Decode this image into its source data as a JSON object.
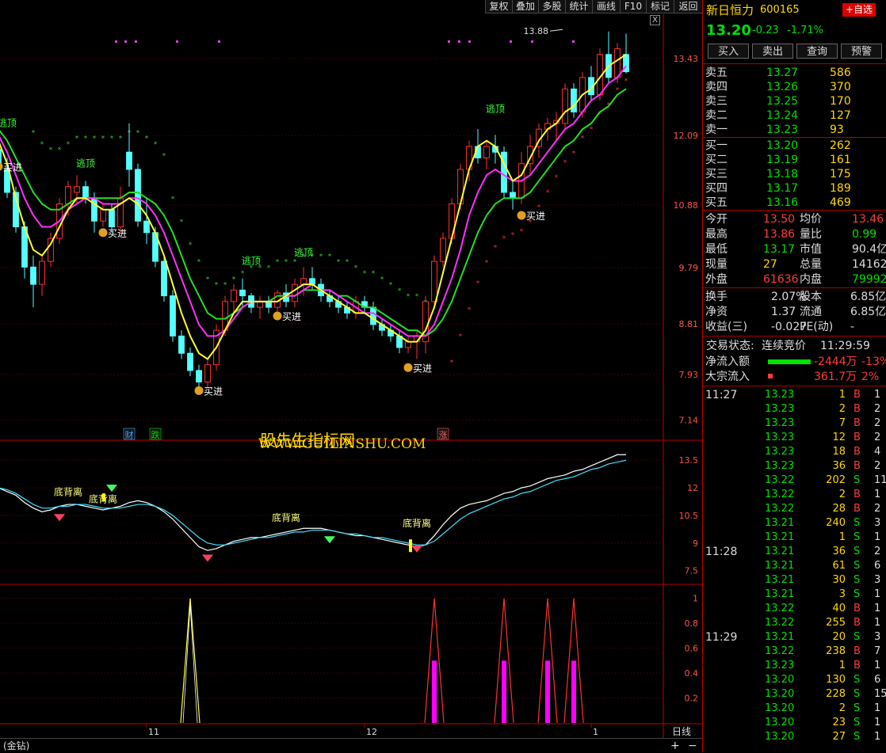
{
  "toolbar": {
    "items": [
      "复权",
      "叠加",
      "多股",
      "统计",
      "画线",
      "F10",
      "标记",
      "返回"
    ]
  },
  "close_glyph": "X",
  "stock": {
    "name": "新日恒力",
    "code": "600165",
    "self_select": "+自选",
    "price": "13.20",
    "change": "-0.23",
    "pct": "-1.71%"
  },
  "actions": [
    "买入",
    "卖出",
    "查询",
    "预警"
  ],
  "sell": [
    {
      "label": "卖五",
      "price": "13.27",
      "vol": "586"
    },
    {
      "label": "卖四",
      "price": "13.26",
      "vol": "370"
    },
    {
      "label": "卖三",
      "price": "13.25",
      "vol": "170"
    },
    {
      "label": "卖二",
      "price": "13.24",
      "vol": "127"
    },
    {
      "label": "卖一",
      "price": "13.23",
      "vol": "93"
    }
  ],
  "buy": [
    {
      "label": "买一",
      "price": "13.20",
      "vol": "262"
    },
    {
      "label": "买二",
      "price": "13.19",
      "vol": "161"
    },
    {
      "label": "买三",
      "price": "13.18",
      "vol": "175"
    },
    {
      "label": "买四",
      "price": "13.17",
      "vol": "189"
    },
    {
      "label": "买五",
      "price": "13.16",
      "vol": "469"
    }
  ],
  "stats": [
    {
      "l1": "今开",
      "v1": "13.50",
      "l2": "均价",
      "v2": "13.46"
    },
    {
      "l1": "最高",
      "v1": "13.86",
      "l2": "量比",
      "v2": "0.99"
    },
    {
      "l1": "最低",
      "v1": "13.17",
      "l2": "市值",
      "v2": "90.4亿"
    },
    {
      "l1": "现量",
      "v1": "27",
      "l2": "总量",
      "v2": "14162"
    },
    {
      "l1": "外盘",
      "v1": "61636",
      "l2": "内盘",
      "v2": "79992"
    }
  ],
  "stats2": [
    {
      "l1": "换手",
      "v1": "2.07%",
      "l2": "股本",
      "v2": "6.85亿"
    },
    {
      "l1": "净资",
      "v1": "1.37",
      "l2": "流通",
      "v2": "6.85亿"
    },
    {
      "l1": "收益(三)",
      "v1": "-0.027",
      "l2": "PE(动)",
      "v2": "-"
    }
  ],
  "trade_status": {
    "label": "交易状态:",
    "value": "连续竞价",
    "time": "11:29:59"
  },
  "flows": [
    {
      "label": "净流入额",
      "value": "-2444万",
      "pct": "-13%"
    },
    {
      "label": "大宗流入",
      "value": "361.7万",
      "pct": "2%"
    }
  ],
  "ticks": [
    {
      "t": "11:27",
      "p": "13.23",
      "v": "1",
      "s": "B",
      "n": "1"
    },
    {
      "t": "",
      "p": "13.23",
      "v": "2",
      "s": "B",
      "n": "2"
    },
    {
      "t": "",
      "p": "13.23",
      "v": "7",
      "s": "B",
      "n": "2"
    },
    {
      "t": "",
      "p": "13.23",
      "v": "12",
      "s": "B",
      "n": "2"
    },
    {
      "t": "",
      "p": "13.23",
      "v": "18",
      "s": "B",
      "n": "4"
    },
    {
      "t": "",
      "p": "13.23",
      "v": "36",
      "s": "B",
      "n": "2"
    },
    {
      "t": "",
      "p": "13.22",
      "v": "202",
      "s": "S",
      "n": "11"
    },
    {
      "t": "",
      "p": "13.22",
      "v": "2",
      "s": "B",
      "n": "1"
    },
    {
      "t": "",
      "p": "13.22",
      "v": "28",
      "s": "B",
      "n": "2"
    },
    {
      "t": "",
      "p": "13.21",
      "v": "240",
      "s": "S",
      "n": "3"
    },
    {
      "t": "",
      "p": "13.21",
      "v": "1",
      "s": "S",
      "n": "1"
    },
    {
      "t": "11:28",
      "p": "13.21",
      "v": "36",
      "s": "S",
      "n": "2"
    },
    {
      "t": "",
      "p": "13.21",
      "v": "61",
      "s": "S",
      "n": "6"
    },
    {
      "t": "",
      "p": "13.21",
      "v": "30",
      "s": "S",
      "n": "3"
    },
    {
      "t": "",
      "p": "13.21",
      "v": "3",
      "s": "S",
      "n": "1"
    },
    {
      "t": "",
      "p": "13.22",
      "v": "40",
      "s": "B",
      "n": "1"
    },
    {
      "t": "",
      "p": "13.22",
      "v": "255",
      "s": "B",
      "n": "1"
    },
    {
      "t": "11:29",
      "p": "13.21",
      "v": "20",
      "s": "S",
      "n": "3"
    },
    {
      "t": "",
      "p": "13.22",
      "v": "238",
      "s": "B",
      "n": "7"
    },
    {
      "t": "",
      "p": "13.23",
      "v": "1",
      "s": "B",
      "n": "1"
    },
    {
      "t": "",
      "p": "13.20",
      "v": "130",
      "s": "S",
      "n": "6"
    },
    {
      "t": "",
      "p": "13.20",
      "v": "228",
      "s": "S",
      "n": "15"
    },
    {
      "t": "",
      "p": "13.20",
      "v": "2",
      "s": "S",
      "n": "1"
    },
    {
      "t": "",
      "p": "13.20",
      "v": "23",
      "s": "S",
      "n": "1"
    },
    {
      "t": "",
      "p": "13.20",
      "v": "27",
      "s": "S",
      "n": "1"
    }
  ],
  "chart_data": {
    "type": "candlestick",
    "price_axis": {
      "ticks": [
        13.43,
        12.09,
        10.88,
        9.79,
        8.81,
        7.93,
        7.14
      ],
      "range": [
        6.8,
        14.2
      ]
    },
    "candles": [
      [
        11.85,
        12.0,
        11.2,
        11.5
      ],
      [
        11.5,
        11.7,
        11.0,
        11.1
      ],
      [
        11.1,
        11.2,
        10.4,
        10.5
      ],
      [
        10.5,
        10.6,
        9.6,
        9.8
      ],
      [
        9.8,
        10.0,
        9.1,
        9.5
      ],
      [
        9.5,
        10.0,
        9.3,
        9.9
      ],
      [
        9.9,
        10.4,
        9.8,
        10.3
      ],
      [
        10.3,
        11.0,
        10.2,
        10.9
      ],
      [
        10.9,
        11.3,
        10.7,
        11.2
      ],
      [
        11.1,
        11.4,
        10.9,
        11.2
      ],
      [
        11.2,
        11.3,
        10.9,
        11.0
      ],
      [
        11.0,
        11.1,
        10.4,
        10.6
      ],
      [
        10.6,
        10.9,
        10.5,
        10.8
      ],
      [
        10.8,
        10.9,
        10.4,
        10.5
      ],
      [
        10.5,
        11.2,
        10.4,
        11.0
      ],
      [
        11.8,
        12.3,
        11.2,
        11.5
      ],
      [
        11.5,
        11.6,
        10.5,
        10.6
      ],
      [
        10.6,
        11.0,
        10.2,
        10.4
      ],
      [
        10.4,
        10.5,
        9.8,
        9.9
      ],
      [
        9.9,
        10.0,
        9.2,
        9.3
      ],
      [
        9.3,
        9.4,
        8.5,
        8.6
      ],
      [
        8.6,
        8.7,
        8.2,
        8.3
      ],
      [
        8.3,
        8.4,
        7.9,
        8.0
      ],
      [
        8.0,
        8.1,
        7.7,
        7.8
      ],
      [
        7.8,
        8.2,
        7.7,
        8.1
      ],
      [
        8.1,
        8.8,
        8.0,
        8.7
      ],
      [
        8.7,
        9.3,
        8.6,
        9.2
      ],
      [
        9.2,
        9.5,
        9.0,
        9.4
      ],
      [
        9.4,
        9.6,
        9.1,
        9.3
      ],
      [
        9.3,
        9.35,
        9.0,
        9.1
      ],
      [
        9.1,
        9.3,
        8.9,
        9.2
      ],
      [
        9.2,
        9.3,
        9.0,
        9.1
      ],
      [
        9.1,
        9.4,
        9.0,
        9.35
      ],
      [
        9.35,
        9.5,
        9.1,
        9.2
      ],
      [
        9.2,
        9.6,
        9.1,
        9.5
      ],
      [
        9.5,
        9.8,
        9.3,
        9.6
      ],
      [
        9.6,
        9.8,
        9.4,
        9.5
      ],
      [
        9.5,
        9.6,
        9.2,
        9.3
      ],
      [
        9.3,
        9.4,
        9.1,
        9.2
      ],
      [
        9.2,
        9.3,
        9.0,
        9.1
      ],
      [
        9.1,
        9.2,
        8.9,
        9.0
      ],
      [
        9.0,
        9.3,
        8.9,
        9.2
      ],
      [
        9.2,
        9.3,
        9.0,
        9.1
      ],
      [
        9.1,
        9.2,
        8.7,
        8.8
      ],
      [
        8.8,
        8.9,
        8.6,
        8.7
      ],
      [
        8.7,
        8.8,
        8.5,
        8.6
      ],
      [
        8.6,
        8.7,
        8.3,
        8.4
      ],
      [
        8.4,
        8.6,
        8.3,
        8.5
      ],
      [
        8.5,
        8.7,
        8.2,
        8.6
      ],
      [
        8.5,
        9.3,
        8.3,
        9.2
      ],
      [
        9.2,
        10.0,
        9.1,
        9.9
      ],
      [
        9.9,
        10.4,
        9.8,
        10.3
      ],
      [
        10.3,
        11.0,
        10.2,
        10.9
      ],
      [
        10.9,
        11.6,
        10.8,
        11.5
      ],
      [
        11.5,
        12.0,
        11.3,
        11.9
      ],
      [
        11.9,
        12.2,
        11.6,
        11.7
      ],
      [
        11.7,
        12.0,
        11.5,
        11.9
      ],
      [
        11.9,
        12.1,
        11.6,
        11.8
      ],
      [
        11.8,
        11.9,
        11.0,
        11.1
      ],
      [
        11.1,
        11.3,
        10.8,
        11.0
      ],
      [
        11.0,
        11.8,
        10.9,
        11.6
      ],
      [
        11.6,
        12.1,
        11.4,
        11.9
      ],
      [
        11.9,
        12.3,
        11.7,
        12.2
      ],
      [
        12.2,
        12.4,
        12.0,
        12.3
      ],
      [
        12.3,
        12.5,
        12.0,
        12.35
      ],
      [
        12.3,
        13.0,
        12.2,
        12.9
      ],
      [
        12.9,
        13.0,
        12.4,
        12.5
      ],
      [
        12.5,
        13.2,
        12.4,
        13.1
      ],
      [
        13.1,
        13.3,
        12.7,
        12.8
      ],
      [
        12.8,
        13.6,
        12.7,
        13.5
      ],
      [
        13.5,
        13.9,
        13.0,
        13.1
      ],
      [
        13.1,
        13.7,
        13.0,
        13.6
      ],
      [
        13.5,
        13.86,
        13.17,
        13.2
      ]
    ],
    "ma_yellow": [
      12.0,
      11.6,
      11.0,
      10.5,
      10.1,
      10.0,
      10.2,
      10.5,
      10.8,
      11.0,
      11.0,
      10.9,
      10.8,
      10.8,
      10.9,
      11.0,
      10.9,
      10.7,
      10.4,
      10.0,
      9.5,
      9.0,
      8.6,
      8.3,
      8.2,
      8.4,
      8.7,
      9.0,
      9.2,
      9.2,
      9.2,
      9.2,
      9.2,
      9.3,
      9.4,
      9.5,
      9.5,
      9.4,
      9.3,
      9.2,
      9.1,
      9.0,
      9.0,
      8.9,
      8.8,
      8.7,
      8.6,
      8.5,
      8.5,
      8.7,
      9.1,
      9.7,
      10.3,
      10.9,
      11.5,
      11.9,
      12.0,
      11.9,
      11.6,
      11.3,
      11.4,
      11.7,
      12.0,
      12.2,
      12.3,
      12.5,
      12.6,
      12.8,
      12.9,
      13.1,
      13.3,
      13.4,
      13.5
    ],
    "ma_magenta": [
      12.1,
      11.8,
      11.4,
      11.0,
      10.7,
      10.5,
      10.5,
      10.6,
      10.8,
      10.9,
      11.0,
      11.0,
      10.9,
      10.9,
      10.9,
      11.0,
      11.0,
      10.9,
      10.7,
      10.4,
      10.0,
      9.6,
      9.2,
      8.8,
      8.6,
      8.6,
      8.7,
      8.9,
      9.1,
      9.2,
      9.2,
      9.2,
      9.2,
      9.3,
      9.3,
      9.4,
      9.5,
      9.4,
      9.4,
      9.3,
      9.2,
      9.1,
      9.0,
      9.0,
      8.9,
      8.8,
      8.7,
      8.6,
      8.6,
      8.6,
      8.8,
      9.2,
      9.6,
      10.1,
      10.7,
      11.1,
      11.4,
      11.5,
      11.4,
      11.3,
      11.3,
      11.4,
      11.6,
      11.8,
      12.0,
      12.2,
      12.3,
      12.5,
      12.7,
      12.8,
      13.0,
      13.1,
      13.3
    ],
    "ma_green": [
      12.2,
      12.0,
      11.7,
      11.4,
      11.1,
      10.9,
      10.8,
      10.8,
      10.9,
      11.0,
      11.0,
      11.0,
      11.0,
      11.0,
      11.0,
      11.1,
      11.1,
      11.0,
      10.9,
      10.7,
      10.4,
      10.0,
      9.6,
      9.3,
      9.0,
      8.9,
      8.9,
      9.0,
      9.1,
      9.2,
      9.2,
      9.2,
      9.3,
      9.3,
      9.3,
      9.4,
      9.4,
      9.4,
      9.4,
      9.3,
      9.3,
      9.2,
      9.1,
      9.1,
      9.0,
      8.9,
      8.8,
      8.7,
      8.7,
      8.6,
      8.7,
      8.9,
      9.2,
      9.6,
      10.0,
      10.4,
      10.7,
      10.9,
      11.0,
      11.0,
      11.0,
      11.1,
      11.3,
      11.5,
      11.7,
      11.9,
      12.0,
      12.2,
      12.3,
      12.5,
      12.6,
      12.8,
      12.9
    ],
    "labels": {
      "escape": [
        {
          "i": 1,
          "p": 12.25,
          "text": "逃顶"
        },
        {
          "i": 10,
          "p": 11.55,
          "text": "逃顶"
        },
        {
          "i": 29,
          "p": 9.85,
          "text": "逃顶"
        },
        {
          "i": 35,
          "p": 10.0,
          "text": "逃顶"
        },
        {
          "i": 57,
          "p": 12.5,
          "text": "逃顶"
        }
      ],
      "buy": [
        {
          "i": 0,
          "p": 11.55,
          "text": "买进"
        },
        {
          "i": 12,
          "p": 10.4,
          "text": "买进"
        },
        {
          "i": 23,
          "p": 7.65,
          "text": "买进"
        },
        {
          "i": 32,
          "p": 8.95,
          "text": "买进"
        },
        {
          "i": 47,
          "p": 8.05,
          "text": "买进"
        },
        {
          "i": 60,
          "p": 10.7,
          "text": "买进"
        }
      ],
      "peak": {
        "i": 64,
        "p": 13.88,
        "text": "13.88"
      },
      "badges": [
        {
          "i": 15,
          "text": "财",
          "color": "#4aa8ff"
        },
        {
          "i": 18,
          "text": "跌",
          "color": "#00e000"
        },
        {
          "i": 51,
          "text": "涨",
          "color": "#ff6060"
        }
      ]
    },
    "watermark": [
      "股先生指标网",
      "WWW.GUILINSHU.COM"
    ],
    "osc": {
      "ticks": [
        13.5,
        12.0,
        10.5,
        9.0,
        7.5
      ],
      "range": [
        6.8,
        14.5
      ],
      "white": [
        12.0,
        11.8,
        11.6,
        11.2,
        10.9,
        10.7,
        10.8,
        11.0,
        11.1,
        11.1,
        11.0,
        10.9,
        10.8,
        10.9,
        11.0,
        11.2,
        11.3,
        11.2,
        11.0,
        10.7,
        10.3,
        9.8,
        9.3,
        8.8,
        8.6,
        8.7,
        8.9,
        9.1,
        9.2,
        9.3,
        9.3,
        9.4,
        9.5,
        9.6,
        9.7,
        9.8,
        9.8,
        9.8,
        9.7,
        9.6,
        9.5,
        9.4,
        9.4,
        9.3,
        9.2,
        9.1,
        9.0,
        8.9,
        8.8,
        8.9,
        9.4,
        10.0,
        10.5,
        10.9,
        11.1,
        11.2,
        11.3,
        11.5,
        11.7,
        11.8,
        12.0,
        12.1,
        12.3,
        12.5,
        12.6,
        12.7,
        12.9,
        13.0,
        13.2,
        13.4,
        13.6,
        13.8,
        13.8
      ],
      "cyan": [
        12.0,
        11.9,
        11.7,
        11.4,
        11.1,
        10.9,
        10.9,
        11.0,
        11.0,
        11.1,
        11.1,
        11.0,
        10.9,
        10.9,
        10.9,
        11.0,
        11.1,
        11.1,
        11.0,
        10.8,
        10.5,
        10.1,
        9.7,
        9.3,
        9.0,
        8.9,
        8.9,
        9.0,
        9.1,
        9.2,
        9.3,
        9.3,
        9.4,
        9.5,
        9.6,
        9.6,
        9.7,
        9.7,
        9.7,
        9.6,
        9.5,
        9.5,
        9.4,
        9.3,
        9.3,
        9.2,
        9.1,
        9.0,
        8.9,
        8.9,
        9.1,
        9.5,
        9.9,
        10.3,
        10.6,
        10.8,
        11.0,
        11.2,
        11.4,
        11.5,
        11.7,
        11.8,
        12.0,
        12.2,
        12.4,
        12.5,
        12.6,
        12.8,
        13.0,
        13.1,
        13.3,
        13.4,
        13.5
      ],
      "div_labels": [
        {
          "i": 8,
          "v": 11.6,
          "text": "底背离"
        },
        {
          "i": 12,
          "v": 11.2,
          "text": "底背离"
        },
        {
          "i": 33,
          "v": 10.2,
          "text": "底背离"
        },
        {
          "i": 48,
          "v": 9.9,
          "text": "底背离"
        }
      ],
      "gems_red": [
        {
          "i": 7,
          "v": 10.4
        },
        {
          "i": 24,
          "v": 8.2
        },
        {
          "i": 48,
          "v": 8.7
        }
      ],
      "gems_green": [
        {
          "i": 13,
          "v": 12.0
        },
        {
          "i": 38,
          "v": 9.2
        }
      ]
    },
    "spikes": {
      "ticks": [
        1.0,
        0.8,
        0.6,
        0.4,
        0.2
      ],
      "range": [
        0,
        1.1
      ],
      "items": [
        {
          "i": 22,
          "style": "yellow"
        },
        {
          "i": 50,
          "style": "red"
        },
        {
          "i": 58,
          "style": "red"
        },
        {
          "i": 63,
          "style": "red"
        },
        {
          "i": 66,
          "style": "red"
        }
      ]
    },
    "date_ticks": [
      {
        "i": 17,
        "text": "11"
      },
      {
        "i": 42,
        "text": "12"
      },
      {
        "i": 68,
        "text": "1"
      }
    ],
    "period": "日线",
    "bottom_tab": "(金钻)"
  }
}
